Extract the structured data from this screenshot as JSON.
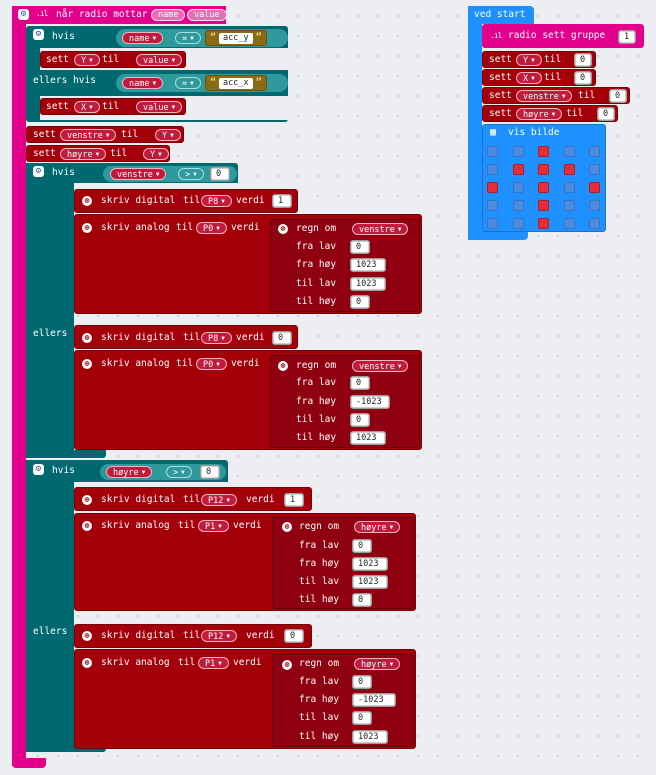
{
  "on_radio": {
    "event_label": "når radio mottar",
    "param_name": "name",
    "param_value": "value",
    "if1": {
      "keyword": "hvis",
      "variable": "name",
      "operator": "=",
      "string": "acc_y",
      "set_keyword": "sett",
      "set_var": "Y",
      "to_keyword": "til",
      "set_value": "value"
    },
    "elseif1": {
      "keyword": "ellers hvis",
      "variable": "name",
      "operator": "=",
      "string": "acc_x",
      "set_keyword": "sett",
      "set_var": "X",
      "to_keyword": "til",
      "set_value": "value"
    },
    "set_left": {
      "keyword": "sett",
      "var": "venstre",
      "to": "til",
      "value": "Y"
    },
    "set_right": {
      "keyword": "sett",
      "var": "høyre",
      "to": "til",
      "value": "Y"
    },
    "if_left": {
      "keyword": "hvis",
      "variable": "venstre",
      "operator": ">",
      "compare_value": "0",
      "digital": {
        "label": "skriv digital",
        "to": "til",
        "pin": "P8",
        "value_label": "verdi",
        "value": "1"
      },
      "analog": {
        "label": "skriv analog",
        "to": "til",
        "pin": "P0",
        "value_label": "verdi",
        "map_label": "regn om",
        "map_var": "venstre",
        "from_low_label": "fra lav",
        "from_low": "0",
        "from_high_label": "fra høy",
        "from_high": "1023",
        "to_low_label": "til lav",
        "to_low": "1023",
        "to_high_label": "til høy",
        "to_high": "0"
      },
      "else_keyword": "ellers",
      "else_digital": {
        "label": "skriv digital",
        "to": "til",
        "pin": "P8",
        "value_label": "verdi",
        "value": "0"
      },
      "else_analog": {
        "label": "skriv analog",
        "to": "til",
        "pin": "P0",
        "value_label": "verdi",
        "map_label": "regn om",
        "map_var": "venstre",
        "from_low_label": "fra lav",
        "from_low": "0",
        "from_high_label": "fra høy",
        "from_high": "-1023",
        "to_low_label": "til lav",
        "to_low": "0",
        "to_high_label": "til høy",
        "to_high": "1023"
      }
    },
    "if_right": {
      "keyword": "hvis",
      "variable": "høyre",
      "operator": ">",
      "compare_value": "0",
      "digital": {
        "label": "skriv digital",
        "to": "til",
        "pin": "P12",
        "value_label": "verdi",
        "value": "1"
      },
      "analog": {
        "label": "skriv analog",
        "to": "til",
        "pin": "P1",
        "value_label": "verdi",
        "map_label": "regn om",
        "map_var": "høyre",
        "from_low_label": "fra lav",
        "from_low": "0",
        "from_high_label": "fra høy",
        "from_high": "1023",
        "to_low_label": "til lav",
        "to_low": "1023",
        "to_high_label": "til høy",
        "to_high": "0"
      },
      "else_keyword": "ellers",
      "else_digital": {
        "label": "skriv digital",
        "to": "til",
        "pin": "P12",
        "value_label": "verdi",
        "value": "0"
      },
      "else_analog": {
        "label": "skriv analog",
        "to": "til",
        "pin": "P1",
        "value_label": "verdi",
        "map_label": "regn om",
        "map_var": "høyre",
        "from_low_label": "fra lav",
        "from_low": "0",
        "from_high_label": "fra høy",
        "from_high": "-1023",
        "to_low_label": "til lav",
        "to_low": "0",
        "to_high_label": "til høy",
        "to_high": "1023"
      }
    }
  },
  "on_start": {
    "label": "ved start",
    "radio_group_label": "radio sett gruppe",
    "radio_group_value": "1",
    "sets": [
      {
        "keyword": "sett",
        "var": "Y",
        "to": "til",
        "value": "0"
      },
      {
        "keyword": "sett",
        "var": "X",
        "to": "til",
        "value": "0"
      },
      {
        "keyword": "sett",
        "var": "venstre",
        "to": "til",
        "value": "0"
      },
      {
        "keyword": "sett",
        "var": "høyre",
        "to": "til",
        "value": "0"
      }
    ],
    "show_image_label": "vis bilde",
    "led_grid": [
      [
        0,
        0,
        1,
        0,
        0
      ],
      [
        0,
        1,
        1,
        1,
        0
      ],
      [
        1,
        0,
        1,
        0,
        1
      ],
      [
        0,
        0,
        1,
        0,
        0
      ],
      [
        0,
        0,
        1,
        0,
        0
      ]
    ]
  },
  "colors": {
    "radio_event": "#e3008c",
    "logic": "#006970",
    "variables": "#a4000a",
    "basic": "#1e90ff",
    "text": "#8a6a14"
  },
  "icons": {
    "gear": "gear-icon",
    "signal": "signal-icon",
    "pin": "pin-icon",
    "grid": "grid-icon",
    "dropdown": "chevron-down-icon"
  }
}
